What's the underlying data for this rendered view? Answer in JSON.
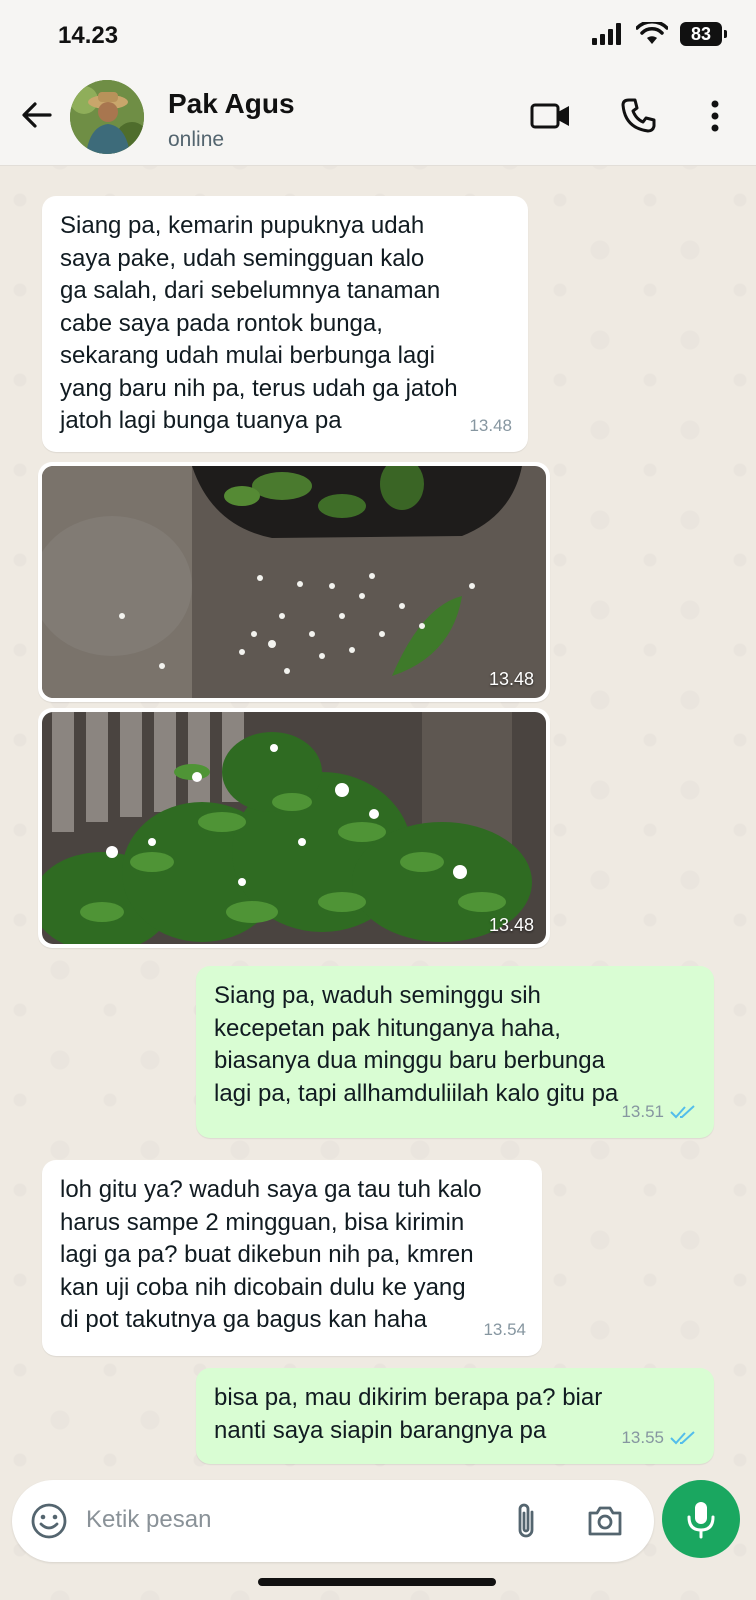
{
  "status_bar": {
    "time": "14.23",
    "battery": "83"
  },
  "header": {
    "contact_name": "Pak Agus",
    "contact_status": "online"
  },
  "messages": [
    {
      "type": "text",
      "direction": "incoming",
      "text": "Siang pa, kemarin pupuknya udah\nsaya pake, udah semingguan kalo\nga salah, dari sebelumnya tanaman\ncabe saya pada rontok bunga,\nsekarang udah mulai berbunga lagi\nyang baru nih pa, terus udah ga jatoh\njatoh lagi bunga tuanya pa",
      "time": "13.48"
    },
    {
      "type": "image",
      "direction": "incoming",
      "subject": "fallen chili flowers on soil beside pot",
      "time": "13.48"
    },
    {
      "type": "image",
      "direction": "incoming",
      "subject": "flowering chili plants",
      "time": "13.48"
    },
    {
      "type": "text",
      "direction": "outgoing",
      "text": "Siang pa, waduh seminggu sih\nkecepetan pak hitunganya haha,\nbiasanya dua minggu baru berbunga\nlagi pa, tapi allhamduliilah kalo gitu pa",
      "time": "13.51",
      "read": true
    },
    {
      "type": "text",
      "direction": "incoming",
      "text": "loh gitu ya? waduh saya ga tau tuh kalo\nharus sampe 2 mingguan, bisa kirimin\nlagi ga pa? buat dikebun nih pa, kmren\nkan uji coba nih dicobain dulu ke yang\ndi pot takutnya ga bagus kan haha",
      "time": "13.54"
    },
    {
      "type": "text",
      "direction": "outgoing",
      "text": "bisa pa, mau dikirim berapa pa? biar\nnanti saya siapin barangnya pa",
      "time": "13.55",
      "read": true
    }
  ],
  "composer": {
    "placeholder": "Ketik pesan"
  },
  "colors": {
    "incoming_bubble": "#ffffff",
    "outgoing_bubble": "#d9fdd3",
    "accent": "#1aa760",
    "read_tick": "#53bdeb"
  }
}
